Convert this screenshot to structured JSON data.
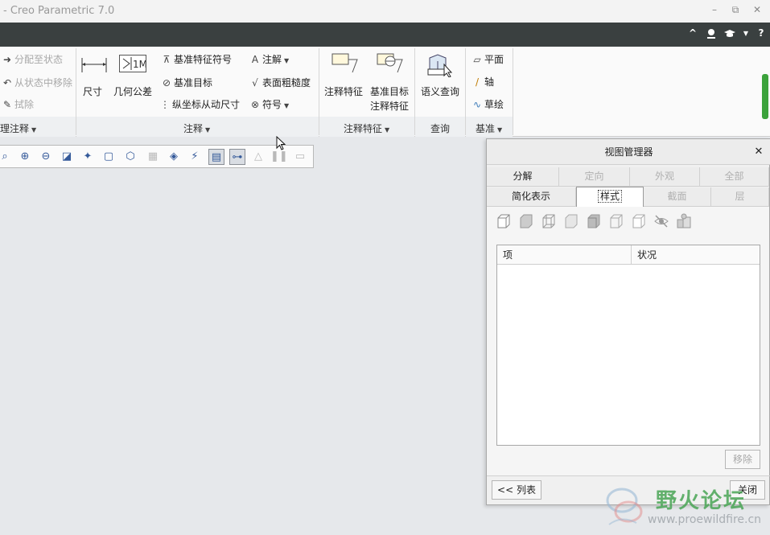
{
  "window": {
    "title": "- Creo Parametric 7.0",
    "minimize": "–",
    "restore": "⧉",
    "close": "✕"
  },
  "topbar": {
    "collapse_icon": "^",
    "help_icon": "?"
  },
  "ribbon": {
    "state_group": {
      "item1": "分配至状态",
      "item2": "从状态中移除",
      "item3": "拭除",
      "label": "理注释"
    },
    "annotate_group": {
      "dimension": "尺寸",
      "gtol": "几何公差",
      "datum_feature_symbol": "基准特征符号",
      "datum_target": "基准目标",
      "ordinate_dim": "纵坐标从动尺寸",
      "note": "注解",
      "surface_finish": "表面粗糙度",
      "symbol": "符号",
      "label": "注释"
    },
    "annotation_feature_group": {
      "annotation_feature": "注释特征",
      "datum_target_feature_line1": "基准目标",
      "datum_target_feature_line2": "注释特征",
      "label": "注释特征"
    },
    "query_group": {
      "semantic_query": "语义查询",
      "label": "查询"
    },
    "datum_group": {
      "plane": "平面",
      "axis": "轴",
      "sketch": "草绘",
      "label": "基准"
    }
  },
  "view_manager": {
    "title": "视图管理器",
    "close_icon": "✕",
    "tabs_row1": [
      "分解",
      "定向",
      "外观",
      "全部"
    ],
    "tabs_row2": [
      "简化表示",
      "样式",
      "截面",
      "层"
    ],
    "active_tab": "样式",
    "table_headers": [
      "项",
      "状况"
    ],
    "remove_button": "移除",
    "list_button": "<< 列表",
    "close_button": "关闭"
  },
  "watermark": {
    "site_name": "野火论坛",
    "url": "www.proewildfire.cn"
  },
  "colors": {
    "darkbar": "#3a4040",
    "accent_green": "#3ba23b",
    "watermark_green": "#4aa556"
  }
}
